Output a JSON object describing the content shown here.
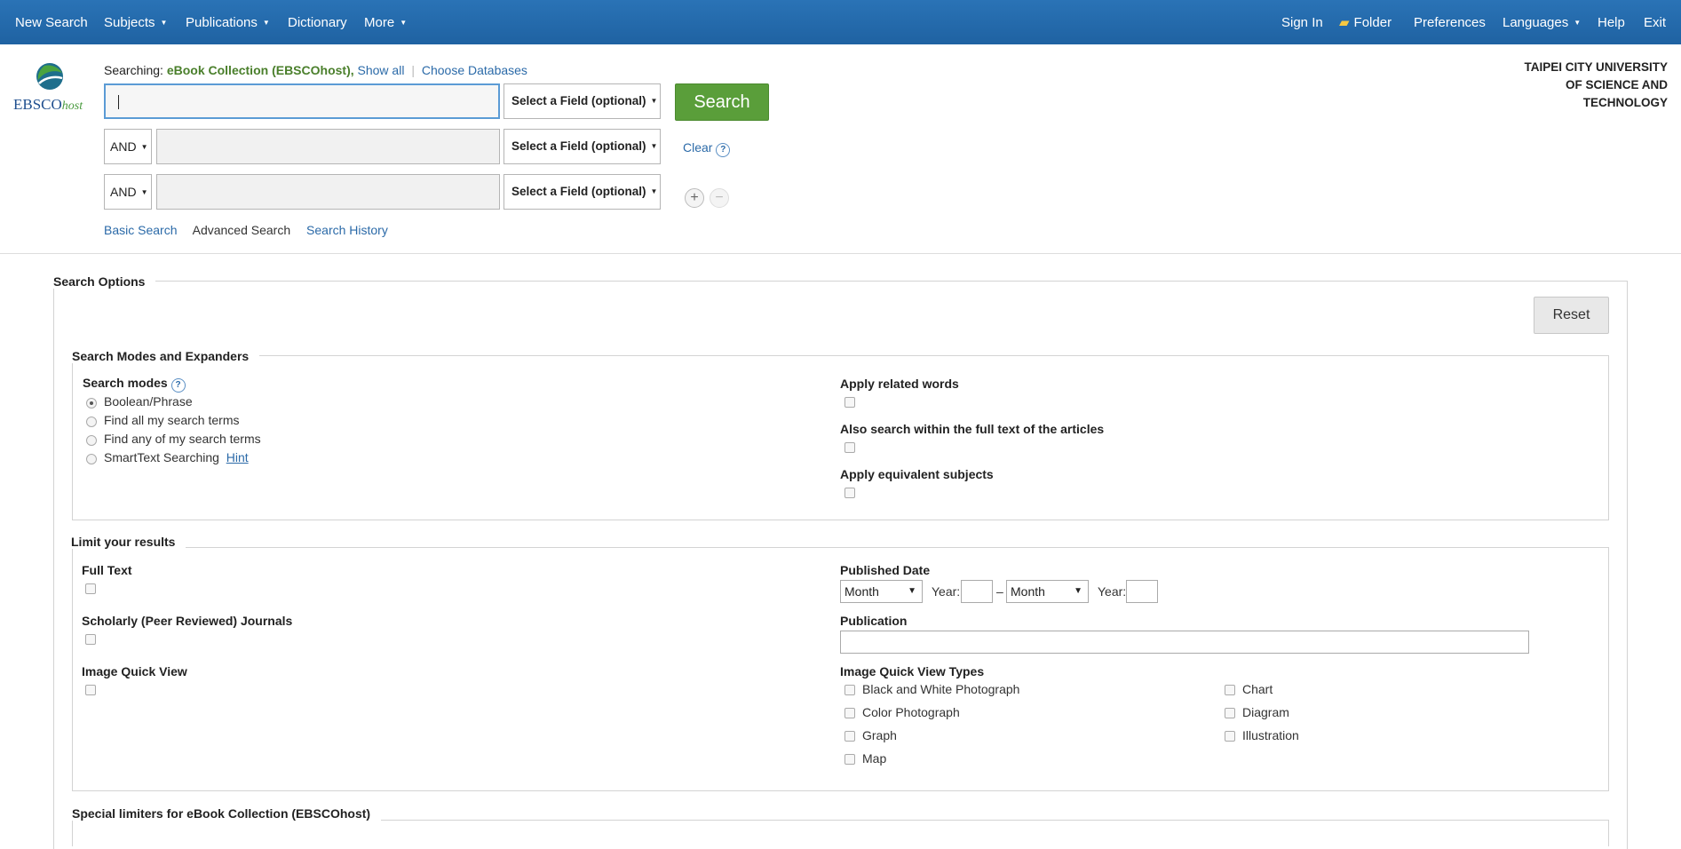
{
  "nav": {
    "new_search": "New Search",
    "subjects": "Subjects",
    "publications": "Publications",
    "dictionary": "Dictionary",
    "more": "More",
    "sign_in": "Sign In",
    "folder": "Folder",
    "preferences": "Preferences",
    "languages": "Languages",
    "help": "Help",
    "exit": "Exit"
  },
  "logo": {
    "text_main": "EBSCO",
    "text_suffix": "host"
  },
  "searching": {
    "prefix": "Searching:",
    "database": "eBook Collection (EBSCOhost),",
    "show_all": "Show all",
    "choose_databases": "Choose Databases"
  },
  "search": {
    "field_label": "Select a Field (optional)",
    "bool1": "AND",
    "bool2": "AND",
    "search_button": "Search",
    "clear": "Clear",
    "help": "?",
    "add": "+",
    "remove": "−"
  },
  "sublinks": {
    "basic": "Basic Search",
    "advanced": "Advanced Search",
    "history": "Search History"
  },
  "org": {
    "line1": "TAIPEI CITY UNIVERSITY",
    "line2": "OF SCIENCE AND",
    "line3": "TECHNOLOGY"
  },
  "options": {
    "title": "Search Options",
    "reset": "Reset",
    "modes_section": "Search Modes and Expanders",
    "modes_label": "Search modes",
    "modes": [
      "Boolean/Phrase",
      "Find all my search terms",
      "Find any of my search terms",
      "SmartText Searching"
    ],
    "modes_selected": "Boolean/Phrase",
    "hint": "Hint",
    "apply_related": "Apply related words",
    "full_text_search": "Also search within the full text of the articles",
    "equivalent_subjects": "Apply equivalent subjects"
  },
  "limits": {
    "title": "Limit your results",
    "full_text": "Full Text",
    "scholarly": "Scholarly (Peer Reviewed) Journals",
    "image_quick_view": "Image Quick View",
    "published_date": "Published Date",
    "month": "Month",
    "year": "Year:",
    "dash": "–",
    "publication": "Publication",
    "iqv_types": "Image Quick View Types",
    "types_left": [
      "Black and White Photograph",
      "Color Photograph",
      "Graph",
      "Map"
    ],
    "types_right": [
      "Chart",
      "Diagram",
      "Illustration"
    ]
  },
  "special": {
    "title": "Special limiters for eBook Collection (EBSCOhost)"
  }
}
